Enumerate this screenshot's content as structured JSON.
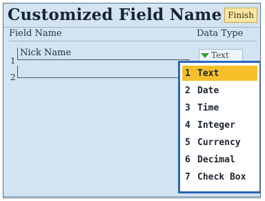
{
  "header": {
    "title": "Customized Field Name",
    "finish_label": "Finish"
  },
  "columns": {
    "field_name": "Field Name",
    "data_type": "Data Type"
  },
  "rows": [
    {
      "number": "1",
      "value": "Nick Name",
      "type": "Text"
    },
    {
      "number": "2",
      "value": ""
    }
  ],
  "dropdown": {
    "selected_index": 0,
    "options": [
      {
        "number": "1",
        "label": "Text"
      },
      {
        "number": "2",
        "label": "Date"
      },
      {
        "number": "3",
        "label": "Time"
      },
      {
        "number": "4",
        "label": "Integer"
      },
      {
        "number": "5",
        "label": "Currency"
      },
      {
        "number": "6",
        "label": "Decimal"
      },
      {
        "number": "7",
        "label": "Check Box"
      }
    ]
  },
  "colors": {
    "background": "#d2e3f1",
    "dropdown_border": "#2a66b8",
    "selected_highlight": "#f5c02a",
    "finish_button": "#f8e7a6",
    "dropdown_arrow": "#2f9e29"
  },
  "icons": {
    "type_select": "green-triangle-down-icon"
  }
}
